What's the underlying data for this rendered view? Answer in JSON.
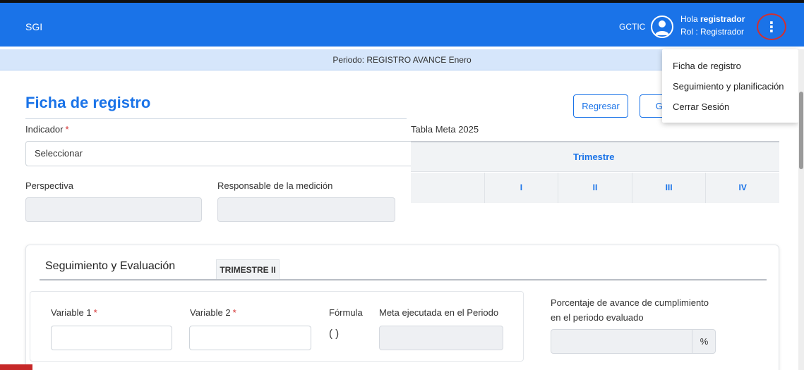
{
  "header": {
    "app_name": "SGI",
    "org": "GCTIC",
    "greeting_prefix": "Hola ",
    "username": "registrador",
    "role": "Rol : Registrador"
  },
  "period": "Periodo: REGISTRO AVANCE Enero",
  "menu": {
    "items": [
      {
        "label": "Ficha de registro"
      },
      {
        "label": "Seguimiento y planificación"
      },
      {
        "label": "Cerrar Sesión"
      }
    ]
  },
  "page": {
    "title": "Ficha de registro",
    "back_label": "Regresar",
    "save_label": "Gua"
  },
  "form": {
    "indicator_label": "Indicador",
    "required_mark": "*",
    "indicator_value": "Seleccionar",
    "perspective_label": "Perspectiva",
    "responsible_label": "Responsable de la medición"
  },
  "meta_table": {
    "title": "Tabla Meta 2025",
    "header": "Trimestre",
    "columns": [
      "",
      "I",
      "II",
      "III",
      "IV"
    ]
  },
  "tracking": {
    "title": "Seguimiento y Evaluación",
    "tab": "TRIMESTRE II",
    "var1_label": "Variable 1",
    "var2_label": "Variable 2",
    "formula_label": "Fórmula",
    "formula_value": "( )",
    "meta_label": "Meta ejecutada en el Periodo",
    "pct_label_line1": "Porcentaje de avance de cumplimiento",
    "pct_label_line2": "en el periodo evaluado",
    "pct_unit": "%"
  }
}
